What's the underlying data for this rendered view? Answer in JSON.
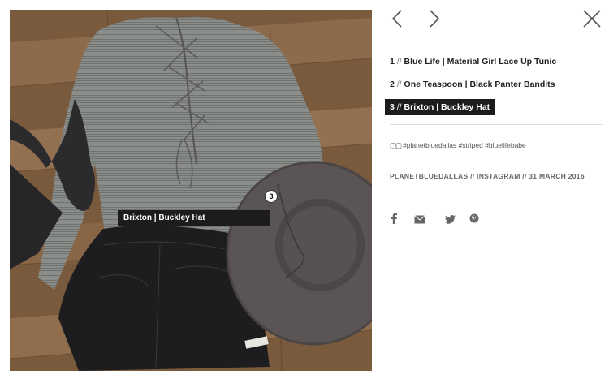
{
  "post": {
    "tag_badge": "3",
    "tag_label": "Brixton | Buckley Hat"
  },
  "products": [
    {
      "num": "1",
      "sep": "//",
      "name": "Blue Life | Material Girl Lace Up Tunic",
      "active": false
    },
    {
      "num": "2",
      "sep": "//",
      "name": "One Teaspoon | Black Panter Bandits",
      "active": false
    },
    {
      "num": "3",
      "sep": "//",
      "name": "Brixton | Buckley Hat",
      "active": true
    }
  ],
  "caption": {
    "emoji": "▢▢",
    "text": "#planetbluedallas #striped #bluelifebabe"
  },
  "source": {
    "text": "PLANETBLUEDALLAS // INSTAGRAM // 31 MARCH 2016"
  },
  "icons": {
    "prev": "chevron-left-icon",
    "next": "chevron-right-icon",
    "close": "close-icon",
    "facebook": "facebook-icon",
    "email": "email-icon",
    "twitter": "twitter-icon",
    "pinterest": "pinterest-icon"
  },
  "colors": {
    "label_bg": "#1c1c1c",
    "text": "#222222",
    "muted": "#666666",
    "divider": "#dcdcdc"
  }
}
